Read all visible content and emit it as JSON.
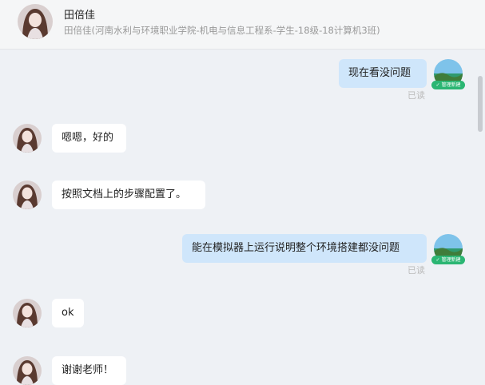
{
  "header": {
    "name": "田倍佳",
    "subtitle": "田倍佳(河南水利与环境职业学院-机电与信息工程系-学生-18级-18计算机3班)"
  },
  "badge_label": "管理新建",
  "messages": [
    {
      "side": "out",
      "text": "现在看没问题",
      "read": "已读"
    },
    {
      "side": "in",
      "text": "嗯嗯，好的"
    },
    {
      "side": "in",
      "text": "按照文档上的步骤配置了。"
    },
    {
      "side": "out",
      "text": "能在模拟器上运行说明整个环境搭建都没问题",
      "read": "已读"
    },
    {
      "side": "in",
      "text": "ok"
    },
    {
      "side": "in",
      "text": "谢谢老师！"
    }
  ],
  "colors": {
    "incoming_bubble": "#ffffff",
    "outgoing_bubble": "#cfe6fb",
    "badge": "#2bb673"
  },
  "icons": {
    "contact_avatar": "girl-portrait-icon",
    "self_avatar": "landscape-avatar-icon",
    "verified_badge": "verified-check-icon"
  }
}
